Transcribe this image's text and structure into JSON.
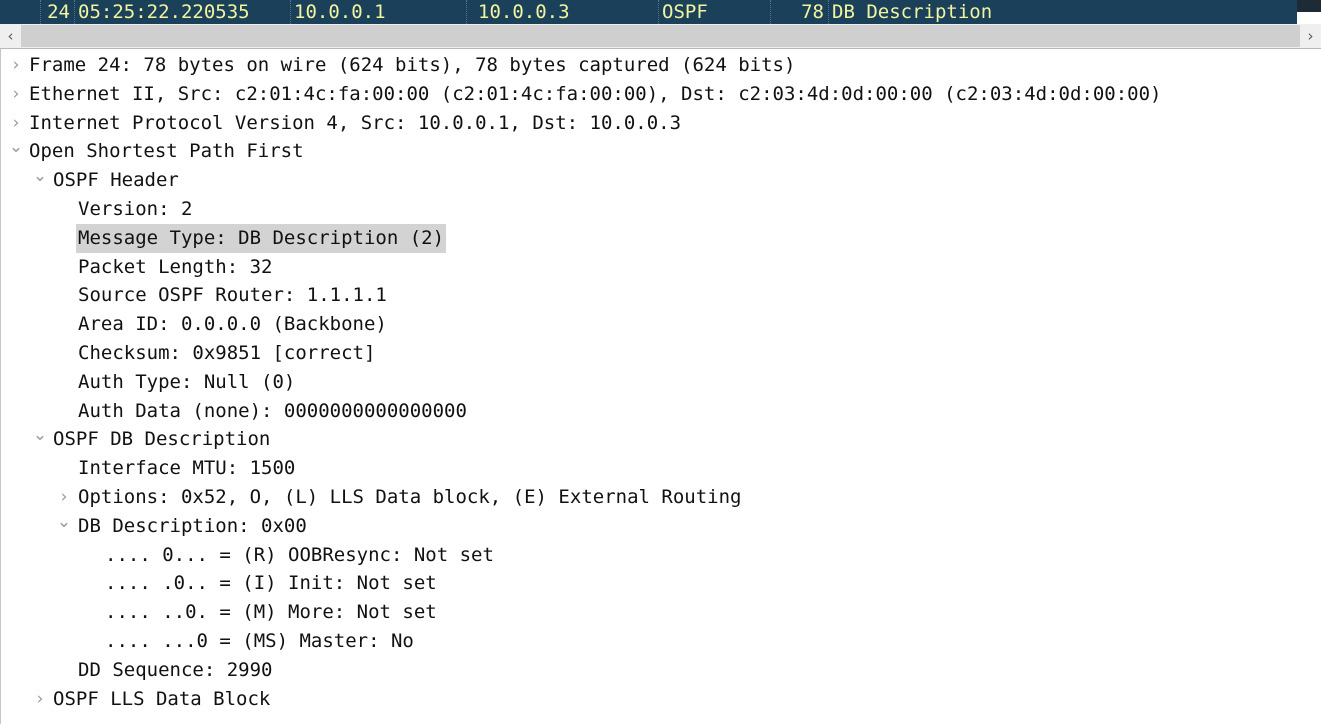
{
  "colors": {
    "selected_row_bg": "#1b4059",
    "selected_row_fg": "#f2f4a0",
    "highlight_bg": "#d3d3d3",
    "scroll_trough": "#cfcfcf",
    "pane_bg": "#ffffff"
  },
  "packet_list": {
    "selected_packet": {
      "no": "24",
      "time": "05:25:22.220535",
      "source": "10.0.0.1",
      "destination": "10.0.0.3",
      "protocol": "OSPF",
      "length": "78",
      "info": "DB Description"
    }
  },
  "scrollbar": {
    "left_arrow": "‹",
    "right_arrow": "›"
  },
  "detail_tree": {
    "rows": [
      {
        "depth": 0,
        "twisty": "closed",
        "text": "Frame 24: 78 bytes on wire (624 bits), 78 bytes captured (624 bits)"
      },
      {
        "depth": 0,
        "twisty": "closed",
        "text": "Ethernet II, Src: c2:01:4c:fa:00:00 (c2:01:4c:fa:00:00), Dst: c2:03:4d:0d:00:00 (c2:03:4d:0d:00:00)"
      },
      {
        "depth": 0,
        "twisty": "closed",
        "text": "Internet Protocol Version 4, Src: 10.0.0.1, Dst: 10.0.0.3"
      },
      {
        "depth": 0,
        "twisty": "open",
        "text": "Open Shortest Path First"
      },
      {
        "depth": 1,
        "twisty": "open",
        "text": "OSPF Header"
      },
      {
        "depth": 2,
        "twisty": "none",
        "text": "Version: 2"
      },
      {
        "depth": 2,
        "twisty": "none",
        "text": "Message Type: DB Description (2)",
        "highlight": true
      },
      {
        "depth": 2,
        "twisty": "none",
        "text": "Packet Length: 32"
      },
      {
        "depth": 2,
        "twisty": "none",
        "text": "Source OSPF Router: 1.1.1.1"
      },
      {
        "depth": 2,
        "twisty": "none",
        "text": "Area ID: 0.0.0.0 (Backbone)"
      },
      {
        "depth": 2,
        "twisty": "none",
        "text": "Checksum: 0x9851 [correct]"
      },
      {
        "depth": 2,
        "twisty": "none",
        "text": "Auth Type: Null (0)"
      },
      {
        "depth": 2,
        "twisty": "none",
        "text": "Auth Data (none): 0000000000000000"
      },
      {
        "depth": 1,
        "twisty": "open",
        "text": "OSPF DB Description"
      },
      {
        "depth": 2,
        "twisty": "none",
        "text": "Interface MTU: 1500"
      },
      {
        "depth": 2,
        "twisty": "closed",
        "text": "Options: 0x52, O, (L) LLS Data block, (E) External Routing"
      },
      {
        "depth": 2,
        "twisty": "open",
        "text": "DB Description: 0x00"
      },
      {
        "depth": 3,
        "twisty": "none",
        "text": ".... 0... = (R) OOBResync: Not set"
      },
      {
        "depth": 3,
        "twisty": "none",
        "text": ".... .0.. = (I) Init: Not set"
      },
      {
        "depth": 3,
        "twisty": "none",
        "text": ".... ..0. = (M) More: Not set"
      },
      {
        "depth": 3,
        "twisty": "none",
        "text": ".... ...0 = (MS) Master: No"
      },
      {
        "depth": 2,
        "twisty": "none",
        "text": "DD Sequence: 2990"
      },
      {
        "depth": 1,
        "twisty": "closed",
        "text": "OSPF LLS Data Block"
      }
    ]
  }
}
